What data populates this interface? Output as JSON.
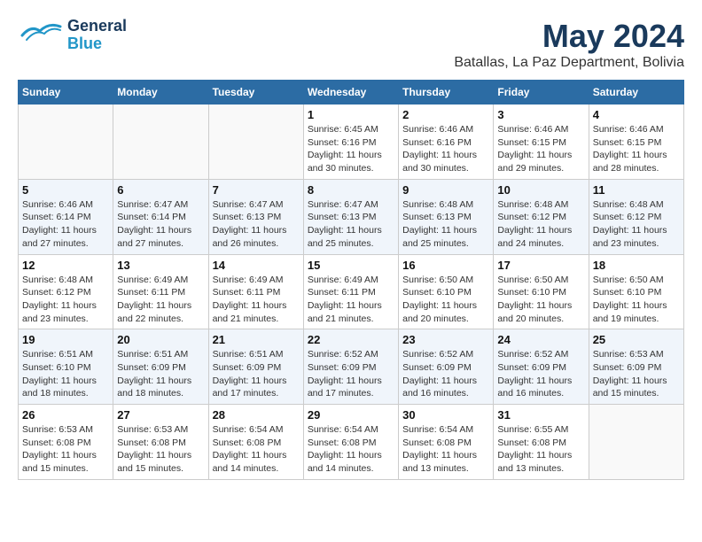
{
  "header": {
    "logo_general": "General",
    "logo_blue": "Blue",
    "month_title": "May 2024",
    "location": "Batallas, La Paz Department, Bolivia"
  },
  "weekdays": [
    "Sunday",
    "Monday",
    "Tuesday",
    "Wednesday",
    "Thursday",
    "Friday",
    "Saturday"
  ],
  "weeks": [
    [
      {
        "day": "",
        "sunrise": "",
        "sunset": "",
        "daylight": ""
      },
      {
        "day": "",
        "sunrise": "",
        "sunset": "",
        "daylight": ""
      },
      {
        "day": "",
        "sunrise": "",
        "sunset": "",
        "daylight": ""
      },
      {
        "day": "1",
        "sunrise": "Sunrise: 6:45 AM",
        "sunset": "Sunset: 6:16 PM",
        "daylight": "Daylight: 11 hours and 30 minutes."
      },
      {
        "day": "2",
        "sunrise": "Sunrise: 6:46 AM",
        "sunset": "Sunset: 6:16 PM",
        "daylight": "Daylight: 11 hours and 30 minutes."
      },
      {
        "day": "3",
        "sunrise": "Sunrise: 6:46 AM",
        "sunset": "Sunset: 6:15 PM",
        "daylight": "Daylight: 11 hours and 29 minutes."
      },
      {
        "day": "4",
        "sunrise": "Sunrise: 6:46 AM",
        "sunset": "Sunset: 6:15 PM",
        "daylight": "Daylight: 11 hours and 28 minutes."
      }
    ],
    [
      {
        "day": "5",
        "sunrise": "Sunrise: 6:46 AM",
        "sunset": "Sunset: 6:14 PM",
        "daylight": "Daylight: 11 hours and 27 minutes."
      },
      {
        "day": "6",
        "sunrise": "Sunrise: 6:47 AM",
        "sunset": "Sunset: 6:14 PM",
        "daylight": "Daylight: 11 hours and 27 minutes."
      },
      {
        "day": "7",
        "sunrise": "Sunrise: 6:47 AM",
        "sunset": "Sunset: 6:13 PM",
        "daylight": "Daylight: 11 hours and 26 minutes."
      },
      {
        "day": "8",
        "sunrise": "Sunrise: 6:47 AM",
        "sunset": "Sunset: 6:13 PM",
        "daylight": "Daylight: 11 hours and 25 minutes."
      },
      {
        "day": "9",
        "sunrise": "Sunrise: 6:48 AM",
        "sunset": "Sunset: 6:13 PM",
        "daylight": "Daylight: 11 hours and 25 minutes."
      },
      {
        "day": "10",
        "sunrise": "Sunrise: 6:48 AM",
        "sunset": "Sunset: 6:12 PM",
        "daylight": "Daylight: 11 hours and 24 minutes."
      },
      {
        "day": "11",
        "sunrise": "Sunrise: 6:48 AM",
        "sunset": "Sunset: 6:12 PM",
        "daylight": "Daylight: 11 hours and 23 minutes."
      }
    ],
    [
      {
        "day": "12",
        "sunrise": "Sunrise: 6:48 AM",
        "sunset": "Sunset: 6:12 PM",
        "daylight": "Daylight: 11 hours and 23 minutes."
      },
      {
        "day": "13",
        "sunrise": "Sunrise: 6:49 AM",
        "sunset": "Sunset: 6:11 PM",
        "daylight": "Daylight: 11 hours and 22 minutes."
      },
      {
        "day": "14",
        "sunrise": "Sunrise: 6:49 AM",
        "sunset": "Sunset: 6:11 PM",
        "daylight": "Daylight: 11 hours and 21 minutes."
      },
      {
        "day": "15",
        "sunrise": "Sunrise: 6:49 AM",
        "sunset": "Sunset: 6:11 PM",
        "daylight": "Daylight: 11 hours and 21 minutes."
      },
      {
        "day": "16",
        "sunrise": "Sunrise: 6:50 AM",
        "sunset": "Sunset: 6:10 PM",
        "daylight": "Daylight: 11 hours and 20 minutes."
      },
      {
        "day": "17",
        "sunrise": "Sunrise: 6:50 AM",
        "sunset": "Sunset: 6:10 PM",
        "daylight": "Daylight: 11 hours and 20 minutes."
      },
      {
        "day": "18",
        "sunrise": "Sunrise: 6:50 AM",
        "sunset": "Sunset: 6:10 PM",
        "daylight": "Daylight: 11 hours and 19 minutes."
      }
    ],
    [
      {
        "day": "19",
        "sunrise": "Sunrise: 6:51 AM",
        "sunset": "Sunset: 6:10 PM",
        "daylight": "Daylight: 11 hours and 18 minutes."
      },
      {
        "day": "20",
        "sunrise": "Sunrise: 6:51 AM",
        "sunset": "Sunset: 6:09 PM",
        "daylight": "Daylight: 11 hours and 18 minutes."
      },
      {
        "day": "21",
        "sunrise": "Sunrise: 6:51 AM",
        "sunset": "Sunset: 6:09 PM",
        "daylight": "Daylight: 11 hours and 17 minutes."
      },
      {
        "day": "22",
        "sunrise": "Sunrise: 6:52 AM",
        "sunset": "Sunset: 6:09 PM",
        "daylight": "Daylight: 11 hours and 17 minutes."
      },
      {
        "day": "23",
        "sunrise": "Sunrise: 6:52 AM",
        "sunset": "Sunset: 6:09 PM",
        "daylight": "Daylight: 11 hours and 16 minutes."
      },
      {
        "day": "24",
        "sunrise": "Sunrise: 6:52 AM",
        "sunset": "Sunset: 6:09 PM",
        "daylight": "Daylight: 11 hours and 16 minutes."
      },
      {
        "day": "25",
        "sunrise": "Sunrise: 6:53 AM",
        "sunset": "Sunset: 6:09 PM",
        "daylight": "Daylight: 11 hours and 15 minutes."
      }
    ],
    [
      {
        "day": "26",
        "sunrise": "Sunrise: 6:53 AM",
        "sunset": "Sunset: 6:08 PM",
        "daylight": "Daylight: 11 hours and 15 minutes."
      },
      {
        "day": "27",
        "sunrise": "Sunrise: 6:53 AM",
        "sunset": "Sunset: 6:08 PM",
        "daylight": "Daylight: 11 hours and 15 minutes."
      },
      {
        "day": "28",
        "sunrise": "Sunrise: 6:54 AM",
        "sunset": "Sunset: 6:08 PM",
        "daylight": "Daylight: 11 hours and 14 minutes."
      },
      {
        "day": "29",
        "sunrise": "Sunrise: 6:54 AM",
        "sunset": "Sunset: 6:08 PM",
        "daylight": "Daylight: 11 hours and 14 minutes."
      },
      {
        "day": "30",
        "sunrise": "Sunrise: 6:54 AM",
        "sunset": "Sunset: 6:08 PM",
        "daylight": "Daylight: 11 hours and 13 minutes."
      },
      {
        "day": "31",
        "sunrise": "Sunrise: 6:55 AM",
        "sunset": "Sunset: 6:08 PM",
        "daylight": "Daylight: 11 hours and 13 minutes."
      },
      {
        "day": "",
        "sunrise": "",
        "sunset": "",
        "daylight": ""
      }
    ]
  ]
}
